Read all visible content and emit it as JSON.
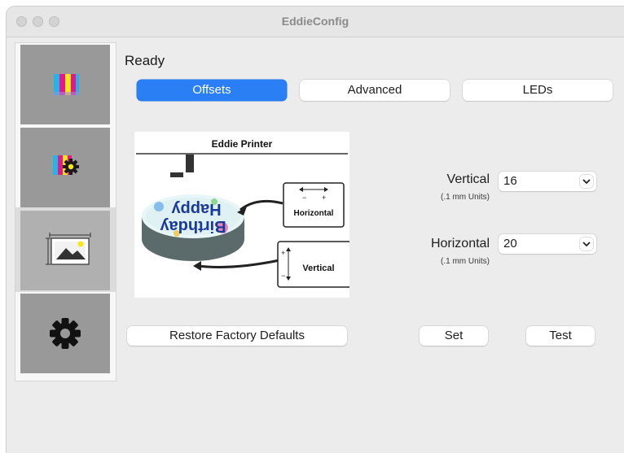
{
  "window": {
    "title": "EddieConfig"
  },
  "sidebar": {
    "items": [
      {
        "name": "color-profile",
        "icon": "color-bars-icon"
      },
      {
        "name": "color-settings",
        "icon": "color-gear-icon"
      },
      {
        "name": "image-offsets",
        "icon": "image-frame-icon",
        "selected": true
      },
      {
        "name": "settings",
        "icon": "gear-icon"
      }
    ]
  },
  "status": "Ready",
  "tabs": [
    {
      "label": "Offsets",
      "active": true
    },
    {
      "label": "Advanced",
      "active": false
    },
    {
      "label": "LEDs",
      "active": false
    }
  ],
  "illustration": {
    "title": "Eddie Printer",
    "cake_text_line1": "Birthday",
    "cake_text_line2": "Happy",
    "horizontal_label": "Horizontal",
    "vertical_label": "Vertical",
    "minus_sign": "−",
    "plus_sign": "+"
  },
  "fields": {
    "vertical": {
      "label": "Vertical",
      "units": "(.1 mm Units)",
      "value": "16"
    },
    "horizontal": {
      "label": "Horizontal",
      "units": "(.1 mm Units)",
      "value": "20"
    }
  },
  "buttons": {
    "restore": "Restore Factory Defaults",
    "set": "Set",
    "test": "Test"
  },
  "colors": {
    "accent": "#2a7ff4",
    "sidebar_tile": "#999999",
    "window_bg": "#ececec"
  }
}
